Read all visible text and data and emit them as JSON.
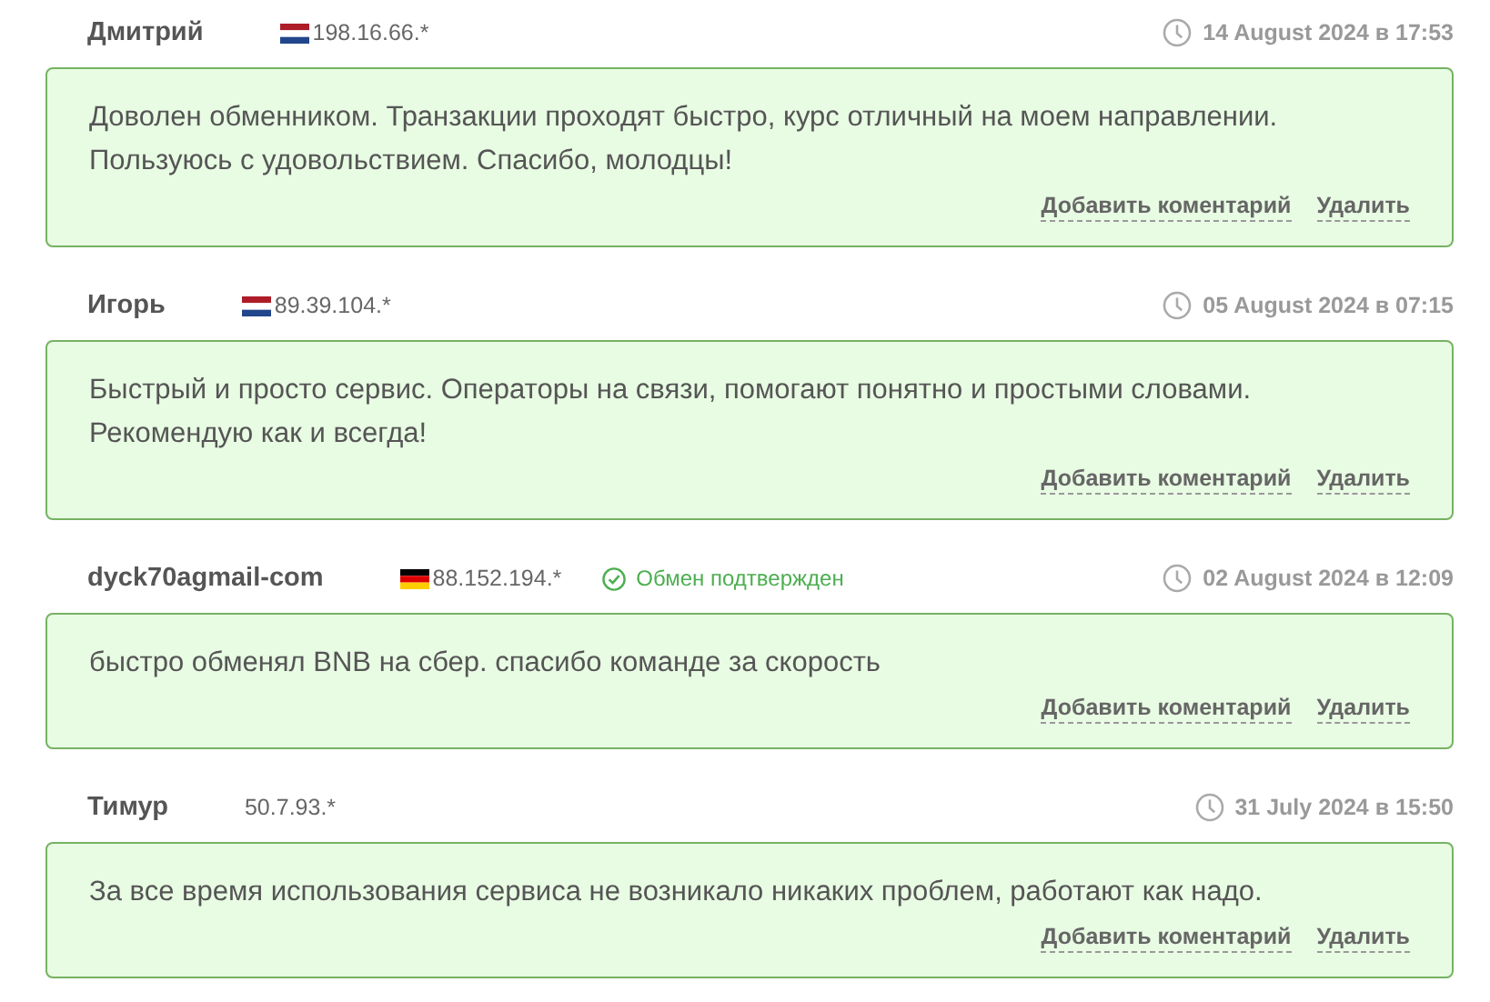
{
  "reviews": [
    {
      "author": "Дмитрий",
      "flag_stripes": [
        {
          "color": "#ae1c28"
        },
        {
          "color": "#ffffff"
        },
        {
          "color": "#21468b"
        }
      ],
      "ip": "198.16.66.*",
      "date": "14 August 2024 в 17:53",
      "text": "Доволен обменником. Транзакции проходят быстро, курс отличный на моем направлении. Пользуюсь с удовольствием. Спасибо, молодцы!",
      "actions": [
        "Добавить коментарий",
        "Удалить"
      ]
    },
    {
      "author": "Игорь",
      "flag_stripes": [
        {
          "color": "#ae1c28"
        },
        {
          "color": "#ffffff"
        },
        {
          "color": "#21468b"
        }
      ],
      "ip": "89.39.104.*",
      "date": "05 August 2024 в 07:15",
      "text": "Быстрый и просто сервис. Операторы на связи, помогают понятно и простыми словами. Рекомендую как и всегда!",
      "actions": [
        "Добавить коментарий",
        "Удалить"
      ]
    },
    {
      "author": "dyck70agmail-com",
      "flag_stripes": [
        {
          "color": "#000000"
        },
        {
          "color": "#dd0000"
        },
        {
          "color": "#ffce00"
        }
      ],
      "ip": "88.152.194.*",
      "verified": "Обмен подтвержден",
      "date": "02 August 2024 в 12:09",
      "text": "быстро обменял BNB на сбер. спасибо команде за скорость",
      "actions": [
        "Добавить коментарий",
        "Удалить"
      ]
    },
    {
      "author": "Тимур",
      "ip": "50.7.93.*",
      "date": "31 July 2024 в 15:50",
      "text": "За все время использования сервиса не возникало никаких проблем, работают как надо.",
      "actions": [
        "Добавить коментарий",
        "Удалить"
      ]
    }
  ]
}
